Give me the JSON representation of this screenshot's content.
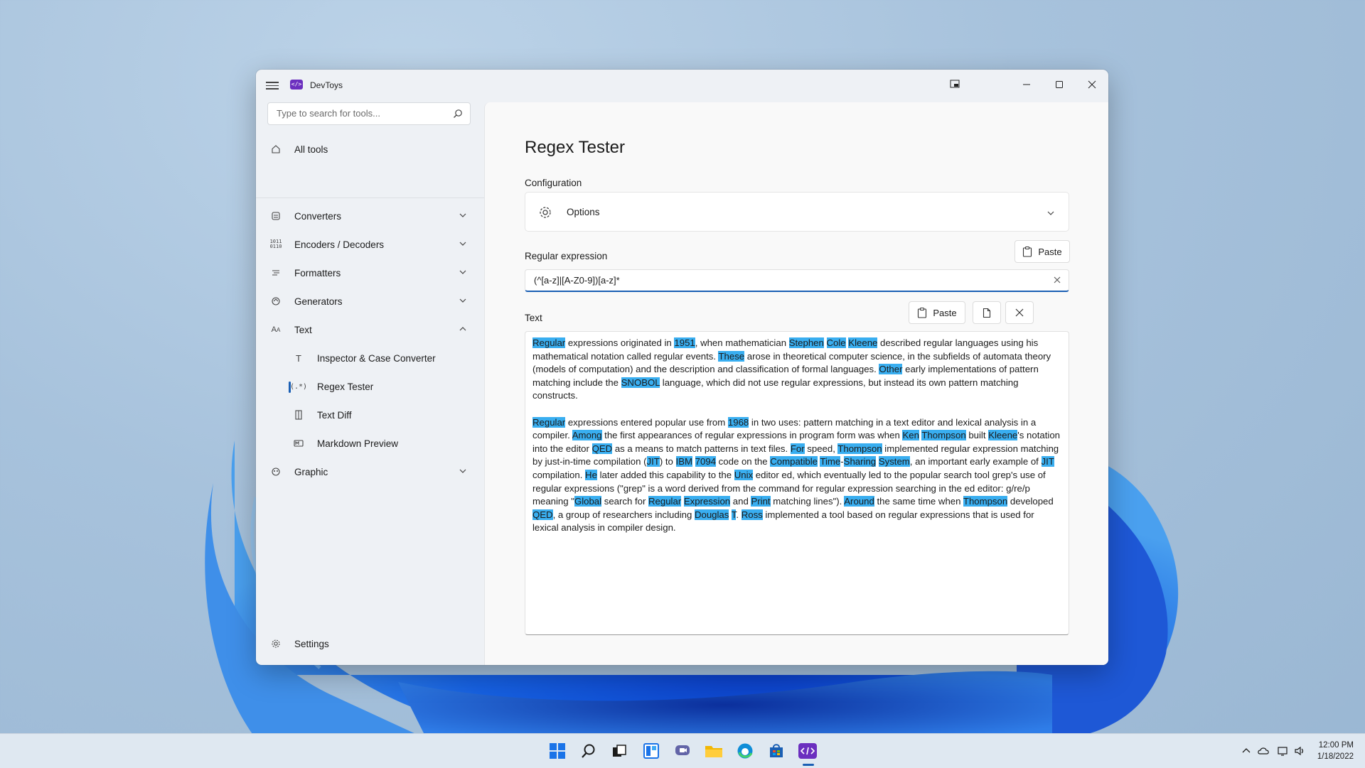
{
  "window": {
    "app_title": "DevToys"
  },
  "sidebar": {
    "search_placeholder": "Type to search for tools...",
    "all_tools": "All tools",
    "groups": [
      {
        "label": "Converters",
        "icon": "converters-icon"
      },
      {
        "label": "Encoders / Decoders",
        "icon": "encoders-icon"
      },
      {
        "label": "Formatters",
        "icon": "formatters-icon"
      },
      {
        "label": "Generators",
        "icon": "generators-icon"
      },
      {
        "label": "Text",
        "icon": "text-icon"
      }
    ],
    "text_items": [
      {
        "label": "Inspector & Case Converter",
        "icon": "text-t-icon"
      },
      {
        "label": "Regex Tester",
        "icon": "regex-icon"
      },
      {
        "label": "Text Diff",
        "icon": "text-diff-icon"
      },
      {
        "label": "Markdown Preview",
        "icon": "markdown-icon"
      }
    ],
    "graphic": "Graphic",
    "settings": "Settings"
  },
  "main": {
    "title": "Regex Tester",
    "configuration_label": "Configuration",
    "options_label": "Options",
    "regex_label": "Regular expression",
    "paste_label": "Paste",
    "regex_value": "(^[a-z]|[A-Z0-9])[a-z]*",
    "text_label": "Text",
    "text_paragraphs": [
      [
        {
          "t": "Regular",
          "m": true
        },
        {
          "t": " expressions originated in "
        },
        {
          "t": "1951",
          "m": true
        },
        {
          "t": ", when mathematician "
        },
        {
          "t": "Stephen",
          "m": true
        },
        {
          "t": " "
        },
        {
          "t": "Cole",
          "m": true
        },
        {
          "t": " "
        },
        {
          "t": "Kleene",
          "m": true
        },
        {
          "t": " described regular languages using his mathematical notation called regular events. "
        },
        {
          "t": "These",
          "m": true
        },
        {
          "t": " arose in theoretical computer science, in the subfields of automata theory (models of computation) and the description and classification of formal languages. "
        },
        {
          "t": "Other",
          "m": true
        },
        {
          "t": " early implementations of pattern matching include the "
        },
        {
          "t": "SNOBOL",
          "m": true
        },
        {
          "t": " language, which did not use regular expressions, but instead its own pattern matching constructs."
        }
      ],
      [
        {
          "t": "Regular",
          "m": true
        },
        {
          "t": " expressions entered popular use from "
        },
        {
          "t": "1968",
          "m": true
        },
        {
          "t": " in two uses: pattern matching in a text editor and lexical analysis in a compiler. "
        },
        {
          "t": "Among",
          "m": true
        },
        {
          "t": " the first appearances of regular expressions in program form was when "
        },
        {
          "t": "Ken",
          "m": true
        },
        {
          "t": " "
        },
        {
          "t": "Thompson",
          "m": true
        },
        {
          "t": " built "
        },
        {
          "t": "Kleene",
          "m": true
        },
        {
          "t": "'s notation into the editor "
        },
        {
          "t": "QED",
          "m": true
        },
        {
          "t": " as a means to match patterns in text files. "
        },
        {
          "t": "For",
          "m": true
        },
        {
          "t": " speed, "
        },
        {
          "t": "Thompson",
          "m": true
        },
        {
          "t": " implemented regular expression matching by just-in-time compilation ("
        },
        {
          "t": "JIT",
          "m": true
        },
        {
          "t": ") to "
        },
        {
          "t": "IBM",
          "m": true
        },
        {
          "t": " "
        },
        {
          "t": "7094",
          "m": true
        },
        {
          "t": " code on the "
        },
        {
          "t": "Compatible",
          "m": true
        },
        {
          "t": " "
        },
        {
          "t": "Time",
          "m": true
        },
        {
          "t": "-"
        },
        {
          "t": "Sharing",
          "m": true
        },
        {
          "t": " "
        },
        {
          "t": "System",
          "m": true
        },
        {
          "t": ", an important early example of "
        },
        {
          "t": "JIT",
          "m": true
        },
        {
          "t": " compilation. "
        },
        {
          "t": "He",
          "m": true
        },
        {
          "t": " later added this capability to the "
        },
        {
          "t": "Unix",
          "m": true
        },
        {
          "t": " editor ed, which eventually led to the popular search tool grep's use of regular expressions (\"grep\" is a word derived from the command for regular expression searching in the ed editor: g/re/p meaning \""
        },
        {
          "t": "Global",
          "m": true
        },
        {
          "t": " search for "
        },
        {
          "t": "Regular",
          "m": true
        },
        {
          "t": " "
        },
        {
          "t": "Expression",
          "m": true
        },
        {
          "t": " and "
        },
        {
          "t": "Print",
          "m": true
        },
        {
          "t": " matching lines\"). "
        },
        {
          "t": "Around",
          "m": true
        },
        {
          "t": " the same time when "
        },
        {
          "t": "Thompson",
          "m": true
        },
        {
          "t": " developed "
        },
        {
          "t": "QED",
          "m": true
        },
        {
          "t": ", a group of researchers including "
        },
        {
          "t": "Douglas",
          "m": true
        },
        {
          "t": " "
        },
        {
          "t": "T",
          "m": true
        },
        {
          "t": ". "
        },
        {
          "t": "Ross",
          "m": true
        },
        {
          "t": " implemented a tool based on regular expressions that is used for lexical analysis in compiler design."
        }
      ]
    ]
  },
  "colors": {
    "accent": "#1a5fb4",
    "match_highlight": "#39aef0",
    "app_logo": "#6b2fbf"
  },
  "taskbar": {
    "apps": [
      "start-icon",
      "search-icon",
      "task-view-icon",
      "widgets-icon",
      "chat-icon",
      "file-explorer-icon",
      "edge-icon",
      "store-icon",
      "devtoys-icon"
    ],
    "time": "12:00 PM",
    "date": "1/18/2022"
  }
}
